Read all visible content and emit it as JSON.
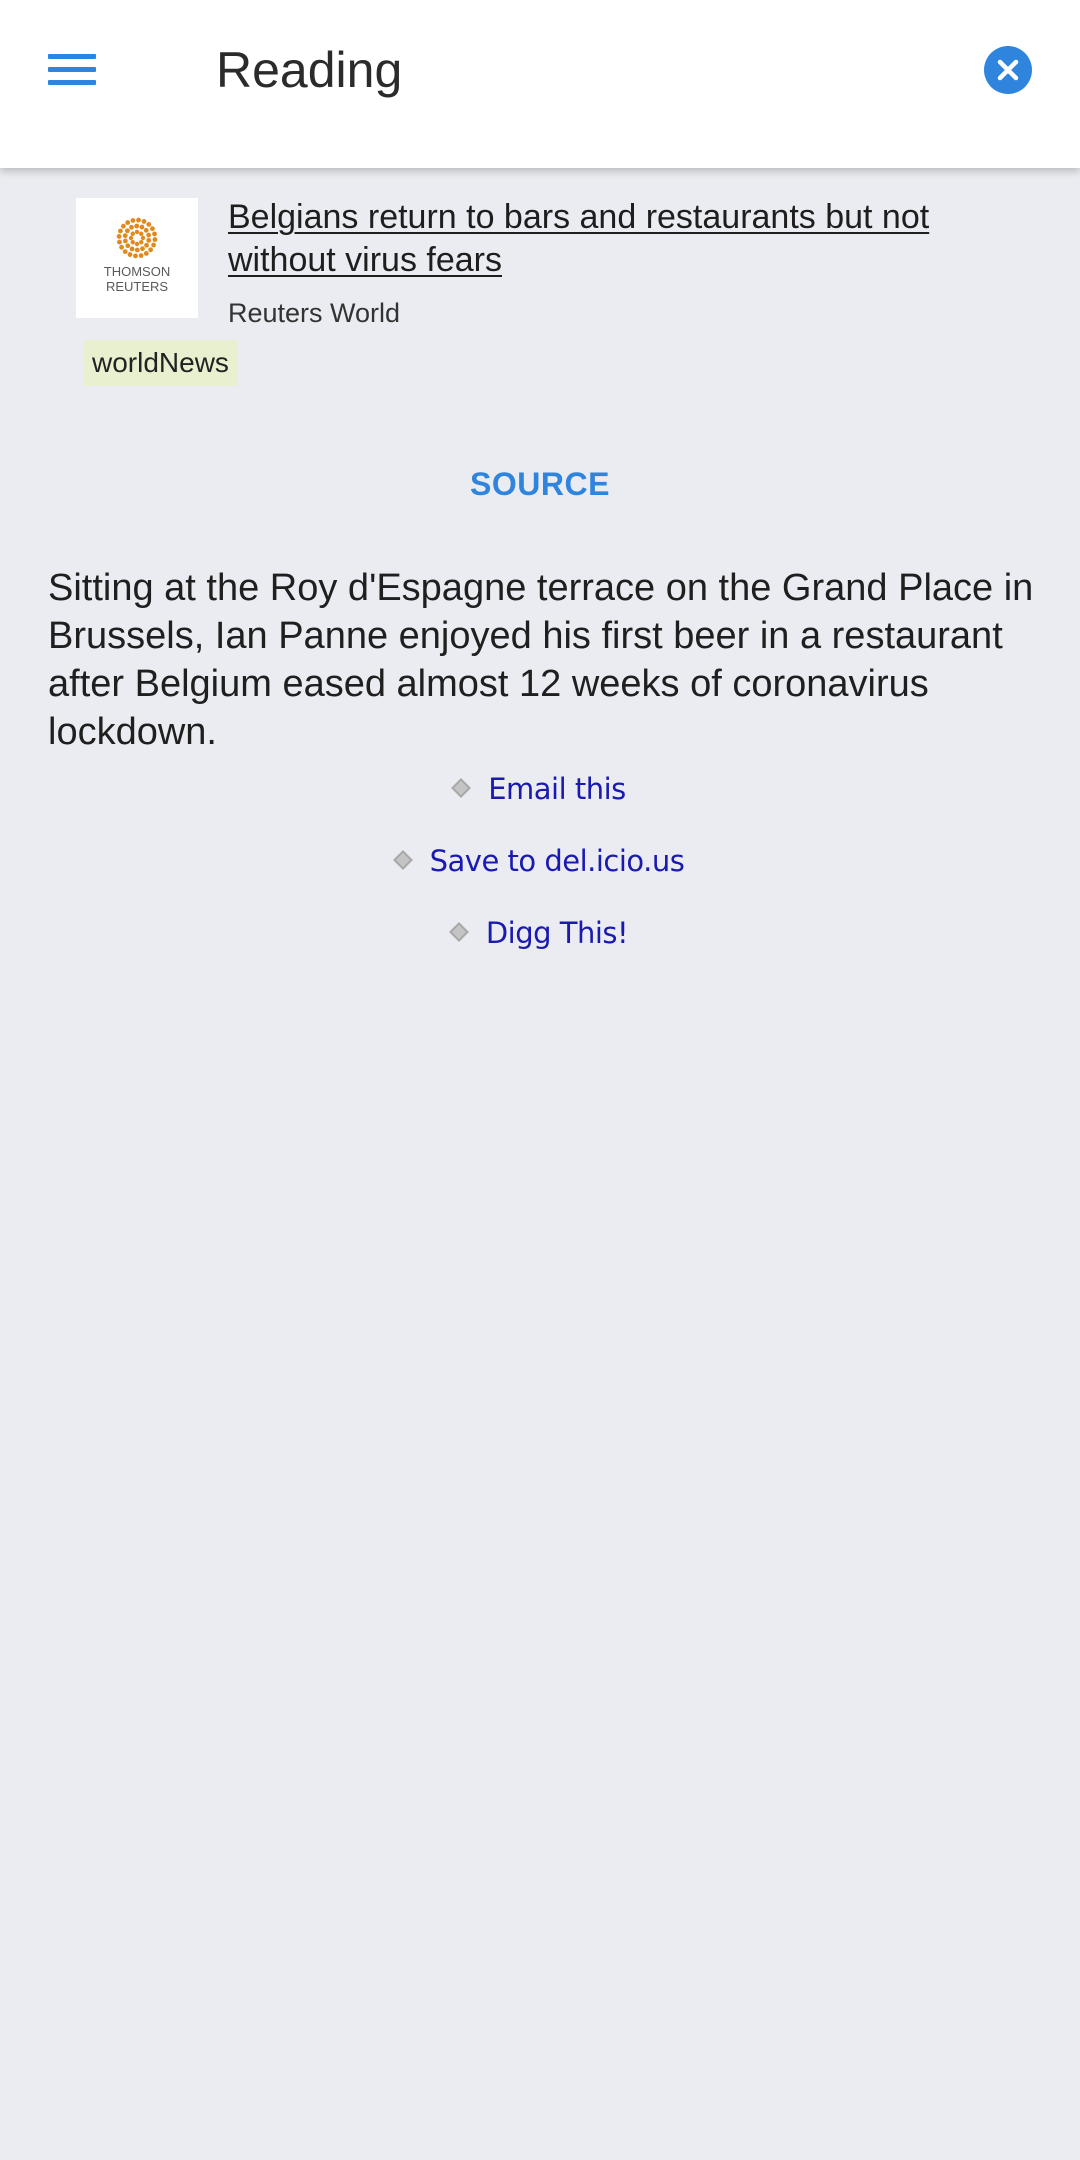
{
  "app_bar": {
    "title": "Reading",
    "menu_icon": "hamburger-menu-icon",
    "close_icon": "close-circle-icon",
    "accent_color": "#2f84dd"
  },
  "article": {
    "thumbnail_text": "THOMSON\nREUTERS",
    "thumbnail_accent_color": "#e08a1e",
    "headline": "Belgians return to bars and restaurants but not without virus fears",
    "source_name": "Reuters World",
    "tag": "worldNews",
    "tag_color": "#e9f0cf",
    "source_link_label": "SOURCE",
    "body": "Sitting at the Roy d'Espagne terrace on the Grand Place in Brussels, Ian Panne enjoyed his first beer in a restaurant after Belgium eased almost 12 weeks of coronavirus lockdown."
  },
  "share_links": [
    {
      "label": "Email this"
    },
    {
      "label": "Save to del.icio.us"
    },
    {
      "label": "Digg This!"
    }
  ],
  "colors": {
    "background": "#eaecf1",
    "link_blue": "#1a1ab0"
  }
}
